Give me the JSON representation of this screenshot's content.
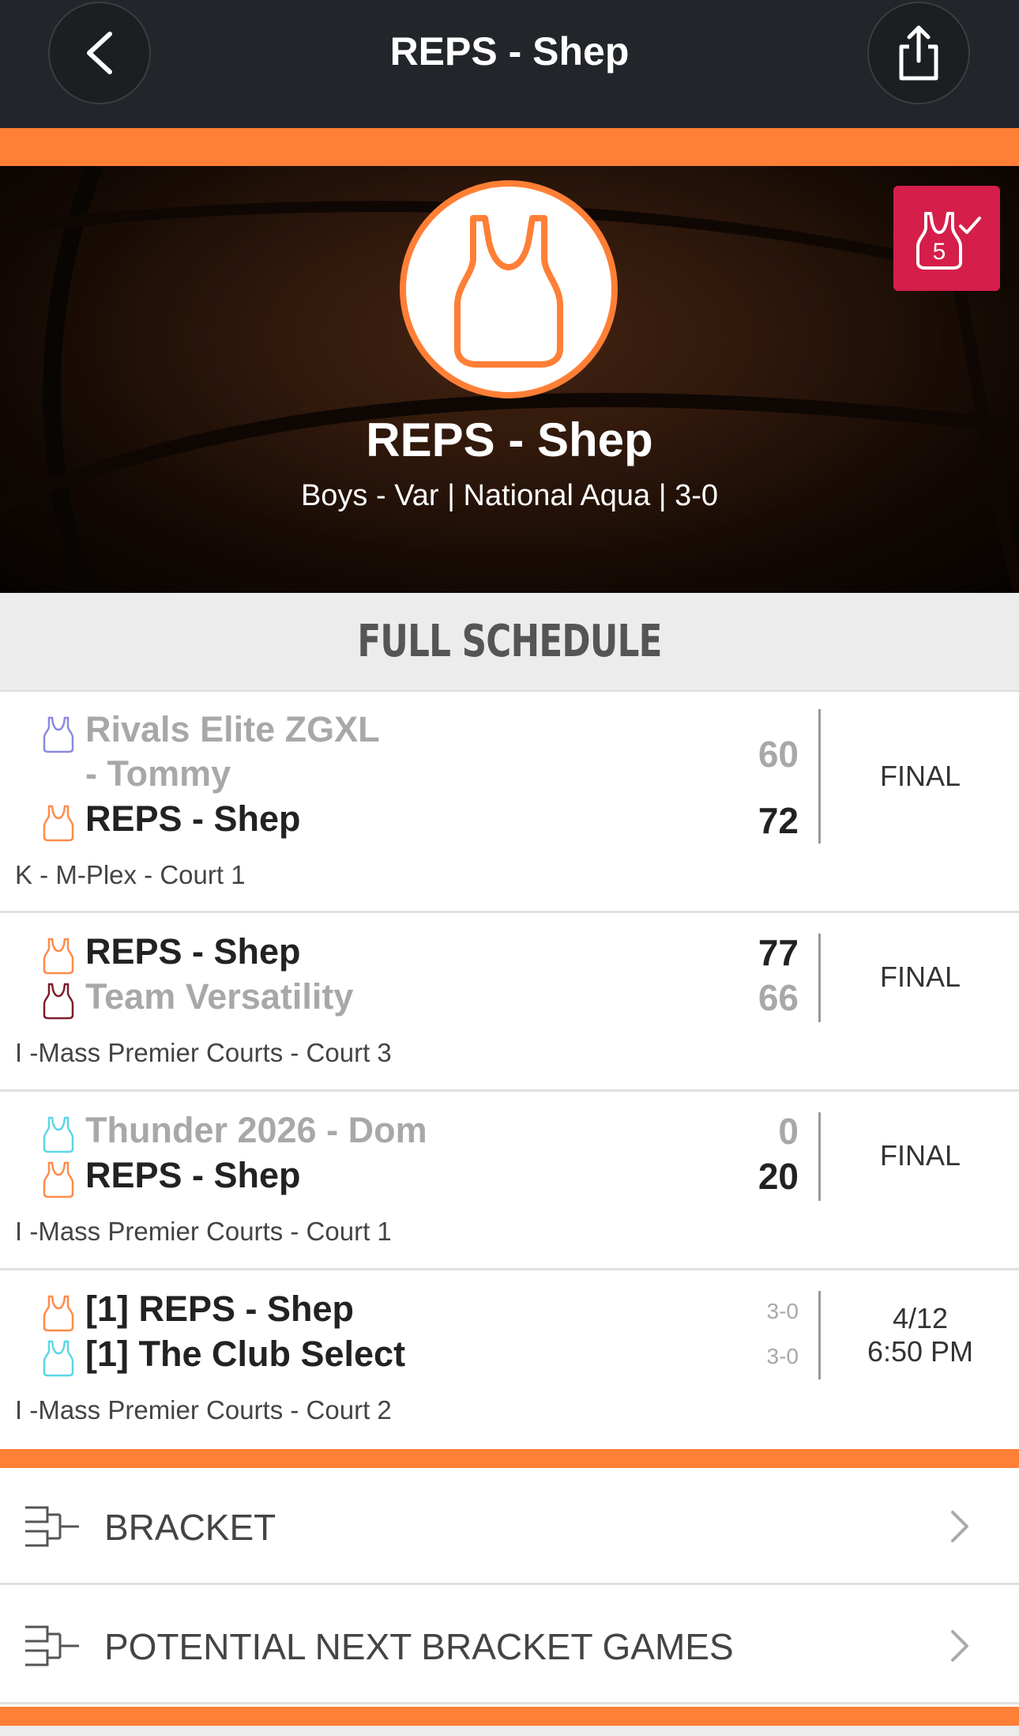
{
  "nav": {
    "title": "REPS - Shep",
    "back_icon": "back-arrow-icon",
    "share_icon": "share-icon"
  },
  "hero": {
    "team": "REPS - Shep",
    "subtitle": "Boys - Var | National Aqua | 3-0",
    "badge_number": "5",
    "accent_color": "#ff7f36",
    "badge_color": "#d51e4a"
  },
  "schedule": {
    "title": "FULL SCHEDULE",
    "games": [
      {
        "team1": {
          "name_line1": "Rivals Elite ZGXL",
          "name_line2": "- Tommy",
          "score": "60",
          "jersey_color": "#8a8ae0"
        },
        "team2": {
          "name": "REPS - Shep",
          "score": "72",
          "jersey_color": "#ff8a4a"
        },
        "status": "FINAL",
        "location": "K -  M-Plex - Court 1"
      },
      {
        "team1": {
          "name": "REPS - Shep",
          "score": "77",
          "jersey_color": "#ff8a4a"
        },
        "team2": {
          "name": "Team Versatility",
          "score": "66",
          "jersey_color": "#7a1f2a"
        },
        "status": "FINAL",
        "location": "I -Mass Premier Courts - Court 3"
      },
      {
        "team1": {
          "name": "Thunder 2026 - Dom",
          "score": "0",
          "jersey_color": "#5ad6e8"
        },
        "team2": {
          "name": "REPS - Shep",
          "score": "20",
          "jersey_color": "#ff8a4a"
        },
        "status": "FINAL",
        "location": "I -Mass Premier Courts - Court 1"
      },
      {
        "team1": {
          "name": "[1] REPS - Shep",
          "record": "3-0",
          "jersey_color": "#ff8a4a"
        },
        "team2": {
          "name": "[1] The Club Select",
          "record": "3-0",
          "jersey_color": "#5ad6e8"
        },
        "status_date": "4/12",
        "status_time": "6:50 PM",
        "location": "I -Mass Premier Courts - Court 2"
      }
    ]
  },
  "links": [
    {
      "label": "BRACKET",
      "icon": "bracket-icon"
    },
    {
      "label": "POTENTIAL NEXT BRACKET GAMES",
      "icon": "bracket-icon"
    }
  ]
}
